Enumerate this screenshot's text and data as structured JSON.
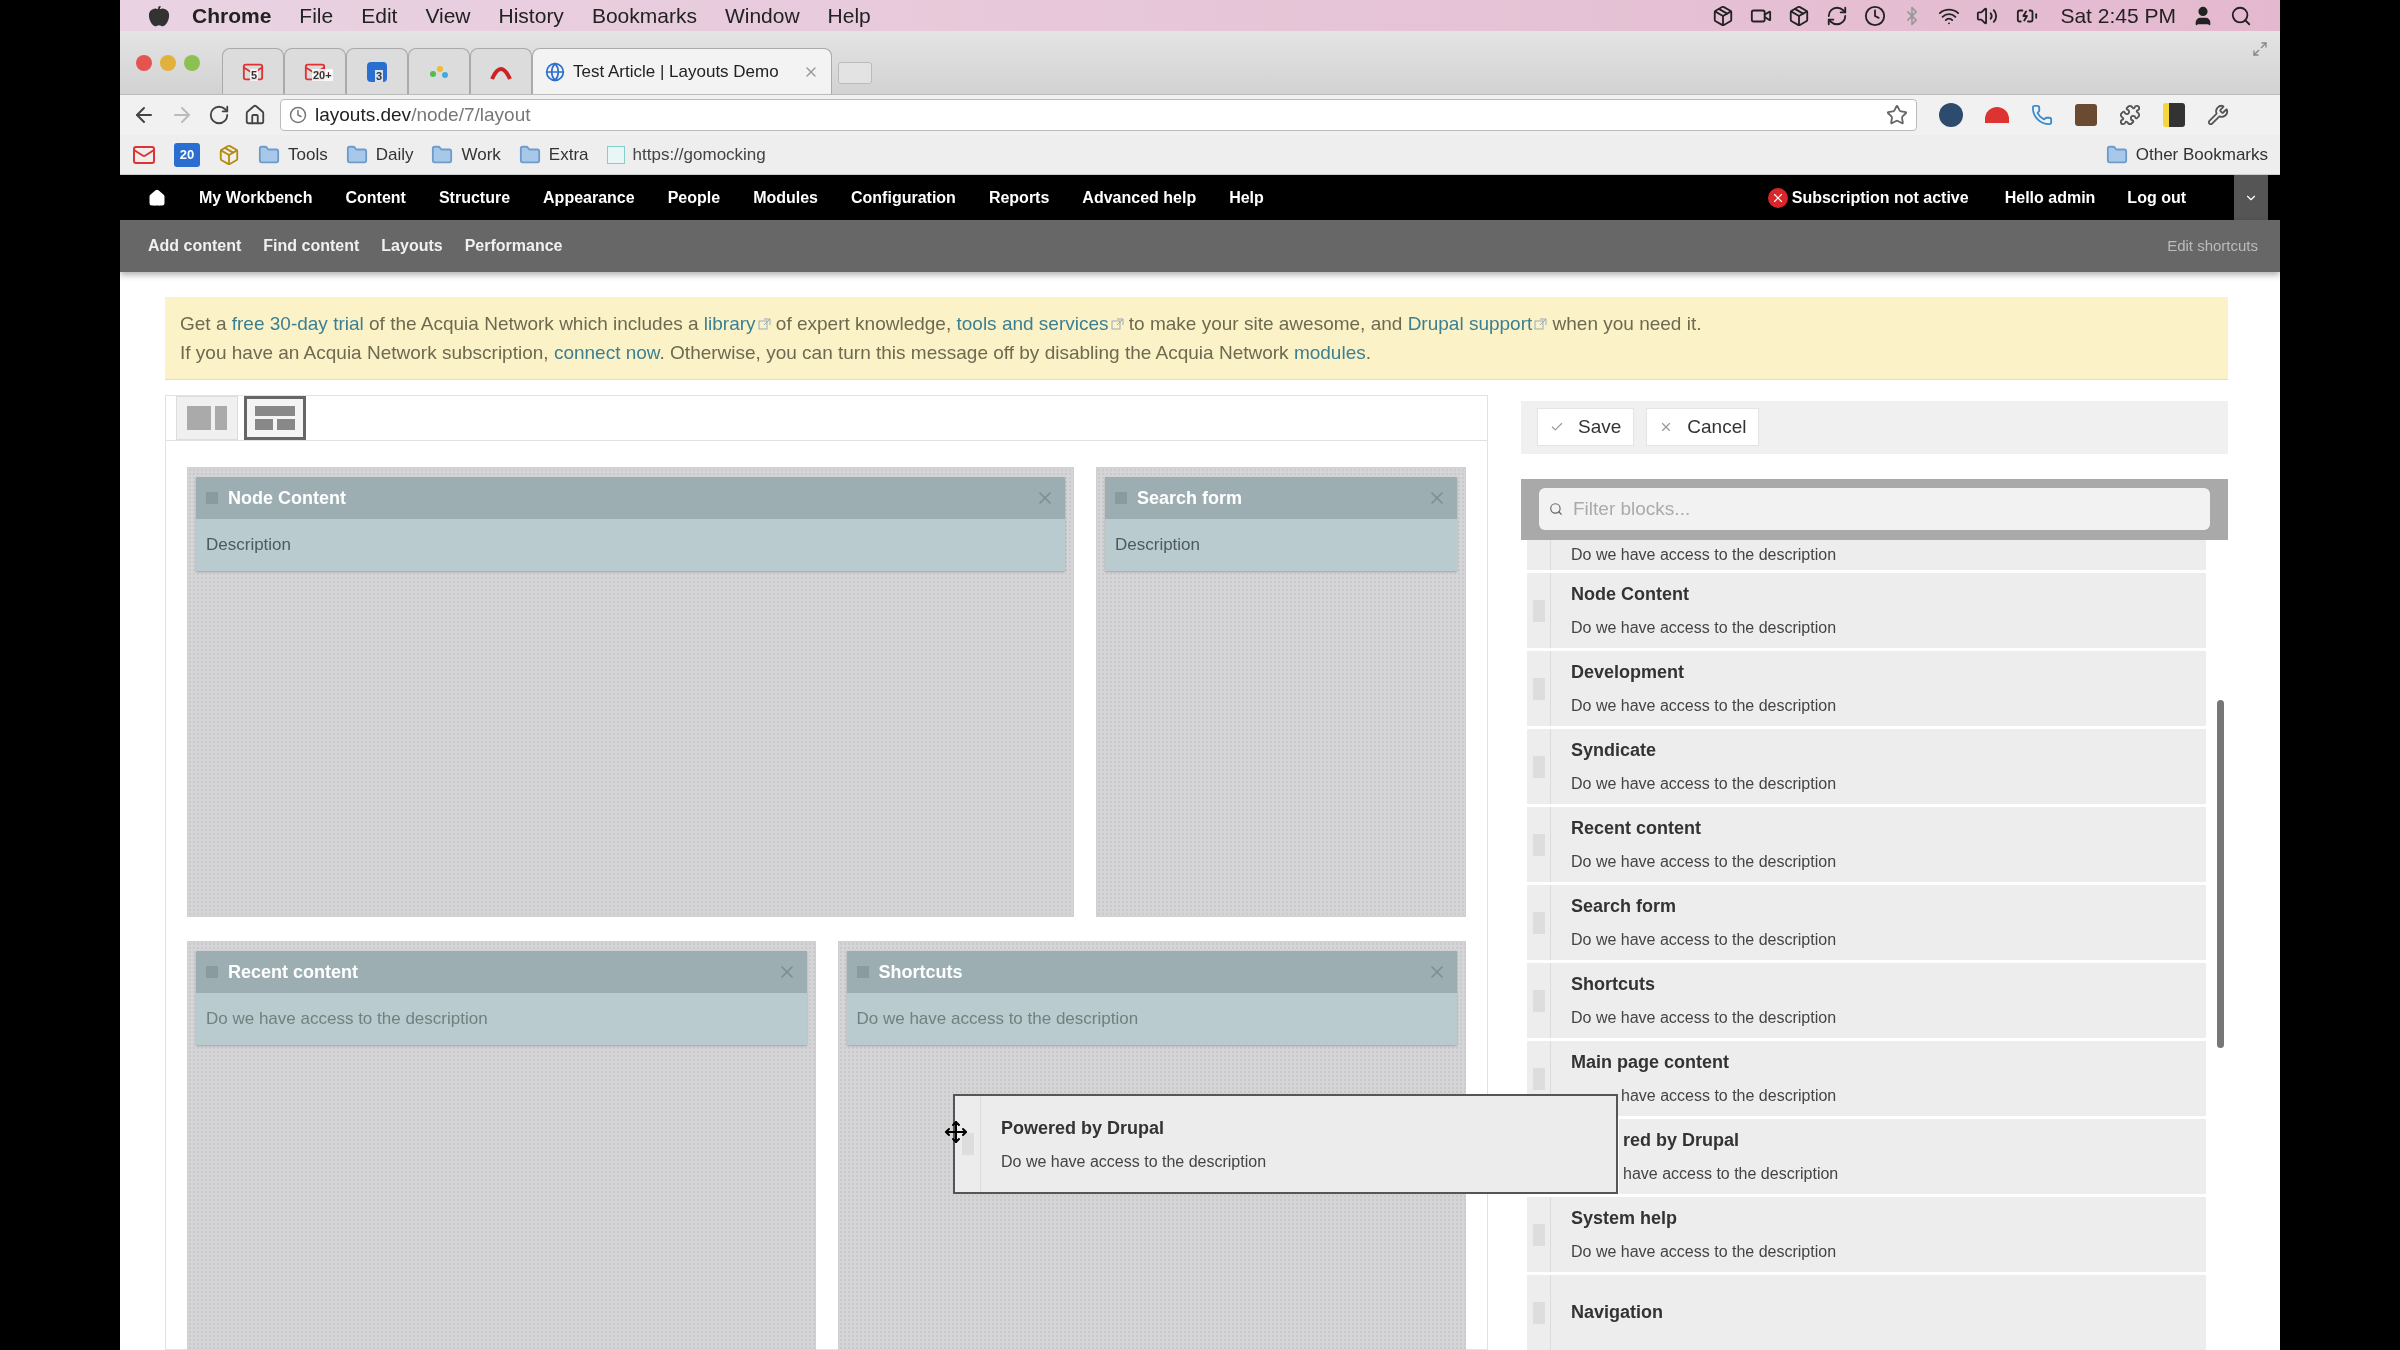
{
  "menubar": {
    "app": "Chrome",
    "items": [
      "File",
      "Edit",
      "View",
      "History",
      "Bookmarks",
      "Window",
      "Help"
    ],
    "clock": "Sat 2:45 PM"
  },
  "tabs": [
    {
      "kind": "mail",
      "badge": "5",
      "selected": false
    },
    {
      "kind": "mail",
      "badge": "20+",
      "selected": false
    },
    {
      "kind": "calendar",
      "badge": "3",
      "selected": false
    },
    {
      "kind": "dots",
      "selected": false
    },
    {
      "kind": "arch",
      "selected": false
    },
    {
      "kind": "page",
      "title": "Test Article | Layouts Demo",
      "selected": true
    }
  ],
  "address": {
    "host": "layouts.dev",
    "path": "/node/7/layout"
  },
  "bookmarks": [
    {
      "kind": "mail"
    },
    {
      "kind": "calendar",
      "label": "20"
    },
    {
      "kind": "app"
    },
    {
      "kind": "folder",
      "label": "Tools"
    },
    {
      "kind": "folder",
      "label": "Daily"
    },
    {
      "kind": "folder",
      "label": "Work"
    },
    {
      "kind": "folder",
      "label": "Extra"
    },
    {
      "kind": "link",
      "label": "https://gomocking"
    }
  ],
  "other_bookmarks": "Other Bookmarks",
  "toolbar": {
    "items": [
      "My Workbench",
      "Content",
      "Structure",
      "Appearance",
      "People",
      "Modules",
      "Configuration",
      "Reports",
      "Advanced help",
      "Help"
    ],
    "subscription": "Subscription not active",
    "user": "Hello admin",
    "logout": "Log out"
  },
  "shortcuts": {
    "items": [
      "Add content",
      "Find content",
      "Layouts",
      "Performance"
    ],
    "edit": "Edit shortcuts"
  },
  "notice": {
    "lines": [
      [
        {
          "kind": "text",
          "text": "Get a "
        },
        {
          "kind": "link",
          "text": "free 30-day trial"
        },
        {
          "kind": "text",
          "text": " of the Acquia Network which includes a "
        },
        {
          "kind": "external",
          "text": "library"
        },
        {
          "kind": "text",
          "text": " of expert knowledge, "
        },
        {
          "kind": "external",
          "text": "tools and services"
        },
        {
          "kind": "text",
          "text": " to make your site awesome, and "
        },
        {
          "kind": "external",
          "text": "Drupal support"
        },
        {
          "kind": "text",
          "text": " when you need it."
        }
      ],
      [
        {
          "kind": "text",
          "text": "If you have an Acquia Network subscription, "
        },
        {
          "kind": "link",
          "text": "connect now"
        },
        {
          "kind": "text",
          "text": ". Otherwise, you can turn this message off by disabling the Acquia Network "
        },
        {
          "kind": "link",
          "text": "modules"
        },
        {
          "kind": "text",
          "text": "."
        }
      ]
    ]
  },
  "layouts": [
    {
      "kind": "columns",
      "selected": false
    },
    {
      "kind": "grid",
      "selected": true
    }
  ],
  "region_rows": [
    {
      "regions": [
        {
          "block": "Node Content",
          "description": "Description"
        },
        {
          "block": "Search form",
          "description": "Description"
        }
      ]
    },
    {
      "regions": [
        {
          "block": "Recent content",
          "description": "Do we have access to the description"
        },
        {
          "block": "Shortcuts",
          "description": "Do we have access to the description"
        }
      ]
    }
  ],
  "actions": {
    "save": "Save",
    "cancel": "Cancel"
  },
  "filter": {
    "placeholder": "Filter blocks..."
  },
  "blocks": [
    {
      "description": "Do we have access to the description"
    },
    {
      "title": "Node Content",
      "description": "Do we have access to the description"
    },
    {
      "title": "Development",
      "description": "Do we have access to the description"
    },
    {
      "title": "Syndicate",
      "description": "Do we have access to the description"
    },
    {
      "title": "Recent content",
      "description": "Do we have access to the description"
    },
    {
      "title": "Search form",
      "description": "Do we have access to the description"
    },
    {
      "title": "Shortcuts",
      "description": "Do we have access to the description"
    },
    {
      "title": "Main page content",
      "description": "have access to the description",
      "description_covered": true
    },
    {
      "title": "red by Drupal",
      "description": "have access to the description",
      "title_covered": true,
      "description_covered": true
    },
    {
      "title": "System help",
      "description": "Do we have access to the description"
    },
    {
      "title": "Navigation"
    }
  ],
  "dragged": {
    "title": "Powered by Drupal",
    "description": "Do we have access to the description"
  }
}
